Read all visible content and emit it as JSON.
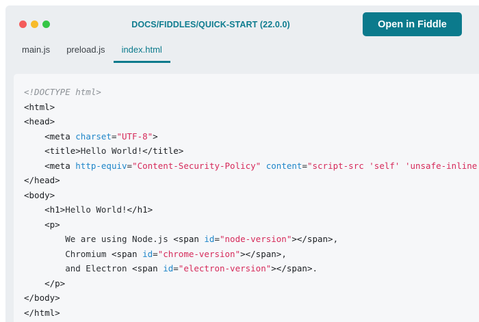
{
  "window": {
    "title": "DOCS/FIDDLES/QUICK-START (22.0.0)",
    "open_button": "Open in Fiddle",
    "dots": [
      "#f45b5b",
      "#f7bb2a",
      "#35c646"
    ]
  },
  "tabs": [
    "main.js",
    "preload.js",
    "index.html"
  ],
  "active_tab": "index.html",
  "colors": {
    "accent": "#0b7a8c",
    "tag": "#1a1d21",
    "attr": "#1f86c9",
    "string": "#d62a5a",
    "comment": "#8c9196",
    "text": "#2b2f33"
  },
  "code_lines": [
    [
      [
        "c",
        "<!DOCTYPE html>"
      ]
    ],
    [
      [
        "t",
        "<html>"
      ]
    ],
    [
      [
        "t",
        "<head>"
      ]
    ],
    [
      [
        "p",
        "    "
      ],
      [
        "t",
        "<meta "
      ],
      [
        "a",
        "charset"
      ],
      [
        "p",
        "="
      ],
      [
        "s",
        "\"UTF-8\""
      ],
      [
        "t",
        ">"
      ]
    ],
    [
      [
        "p",
        "    "
      ],
      [
        "t",
        "<title>"
      ],
      [
        "p",
        "Hello World!"
      ],
      [
        "t",
        "</title>"
      ]
    ],
    [
      [
        "p",
        "    "
      ],
      [
        "t",
        "<meta "
      ],
      [
        "a",
        "http-equiv"
      ],
      [
        "p",
        "="
      ],
      [
        "s",
        "\"Content-Security-Policy\""
      ],
      [
        "p",
        " "
      ],
      [
        "a",
        "content"
      ],
      [
        "p",
        "="
      ],
      [
        "s",
        "\"script-src 'self' 'unsafe-inline';\""
      ],
      [
        "t",
        ">"
      ]
    ],
    [
      [
        "t",
        "</head>"
      ]
    ],
    [
      [
        "t",
        "<body>"
      ]
    ],
    [
      [
        "p",
        "    "
      ],
      [
        "t",
        "<h1>"
      ],
      [
        "p",
        "Hello World!"
      ],
      [
        "t",
        "</h1>"
      ]
    ],
    [
      [
        "p",
        "    "
      ],
      [
        "t",
        "<p>"
      ]
    ],
    [
      [
        "p",
        "        We are using Node.js "
      ],
      [
        "t",
        "<span "
      ],
      [
        "a",
        "id"
      ],
      [
        "p",
        "="
      ],
      [
        "s",
        "\"node-version\""
      ],
      [
        "t",
        "></span>"
      ],
      [
        "p",
        ","
      ]
    ],
    [
      [
        "p",
        "        Chromium "
      ],
      [
        "t",
        "<span "
      ],
      [
        "a",
        "id"
      ],
      [
        "p",
        "="
      ],
      [
        "s",
        "\"chrome-version\""
      ],
      [
        "t",
        "></span>"
      ],
      [
        "p",
        ","
      ]
    ],
    [
      [
        "p",
        "        and Electron "
      ],
      [
        "t",
        "<span "
      ],
      [
        "a",
        "id"
      ],
      [
        "p",
        "="
      ],
      [
        "s",
        "\"electron-version\""
      ],
      [
        "t",
        "></span>"
      ],
      [
        "p",
        "."
      ]
    ],
    [
      [
        "p",
        "    "
      ],
      [
        "t",
        "</p>"
      ]
    ],
    [
      [
        "t",
        "</body>"
      ]
    ],
    [
      [
        "t",
        "</html>"
      ]
    ]
  ]
}
